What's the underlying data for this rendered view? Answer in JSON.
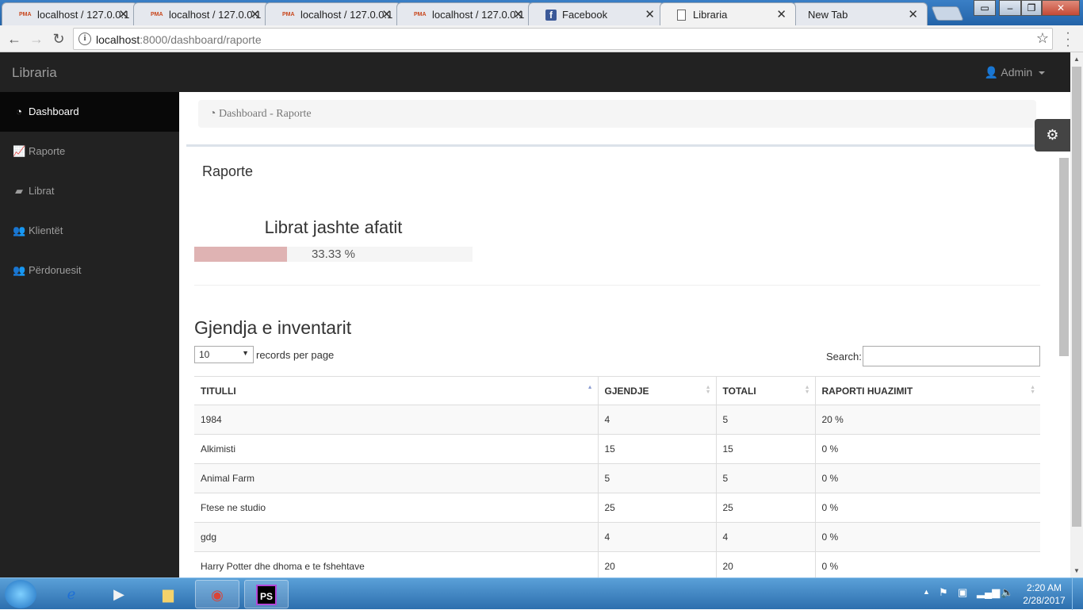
{
  "browser": {
    "tabs": [
      {
        "title": "localhost / 127.0.0.1",
        "icon": "phpmyadmin-icon",
        "active": false
      },
      {
        "title": "localhost / 127.0.0.1",
        "icon": "phpmyadmin-icon",
        "active": false
      },
      {
        "title": "localhost / 127.0.0.1",
        "icon": "phpmyadmin-icon",
        "active": false
      },
      {
        "title": "localhost / 127.0.0.1",
        "icon": "phpmyadmin-icon",
        "active": false
      },
      {
        "title": "Facebook",
        "icon": "facebook-icon",
        "active": false
      },
      {
        "title": "Libraria",
        "icon": "page-icon",
        "active": true
      },
      {
        "title": "New Tab",
        "icon": "",
        "active": false
      }
    ],
    "pma_text": "PMA",
    "fb_text": "f",
    "url_host": "localhost",
    "url_path": ":8000/dashboard/raporte"
  },
  "app": {
    "brand": "Libraria",
    "user_label": "Admin"
  },
  "sidebar": {
    "items": [
      {
        "label": "Dashboard",
        "icon": "dashboard-icon",
        "active": true
      },
      {
        "label": "Raporte",
        "icon": "line-chart-icon",
        "active": false
      },
      {
        "label": "Librat",
        "icon": "book-icon",
        "active": false
      },
      {
        "label": "Klientët",
        "icon": "users-icon",
        "active": false
      },
      {
        "label": "Përdoruesit",
        "icon": "users-icon",
        "active": false
      }
    ]
  },
  "breadcrumb": {
    "text": "Dashboard - Raporte"
  },
  "page": {
    "title": "Raporte",
    "overdue": {
      "title": "Librat jashte afatit",
      "label": "33.33 %",
      "percent": 33.33
    },
    "inventory_title": "Gjendja e inventarit"
  },
  "datatable": {
    "length_value": "10",
    "length_label": "records per page",
    "search_label": "Search:",
    "columns": [
      "TITULLI",
      "GJENDJE",
      "TOTALI",
      "RAPORTI HUAZIMIT"
    ],
    "rows": [
      [
        "1984",
        "4",
        "5",
        "20 %"
      ],
      [
        "Alkimisti",
        "15",
        "15",
        "0 %"
      ],
      [
        "Animal Farm",
        "5",
        "5",
        "0 %"
      ],
      [
        "Ftese ne studio",
        "25",
        "25",
        "0 %"
      ],
      [
        "gdg",
        "4",
        "4",
        "0 %"
      ],
      [
        "Harry Potter dhe dhoma e te fshehtave",
        "20",
        "20",
        "0 %"
      ]
    ]
  },
  "taskbar": {
    "time": "2:20 AM",
    "date": "2/28/2017",
    "phpstorm_label": "PS"
  },
  "colors": {
    "navbar": "#222222",
    "progress_fill": "#dfb3b3",
    "settings_button": "#444444"
  }
}
